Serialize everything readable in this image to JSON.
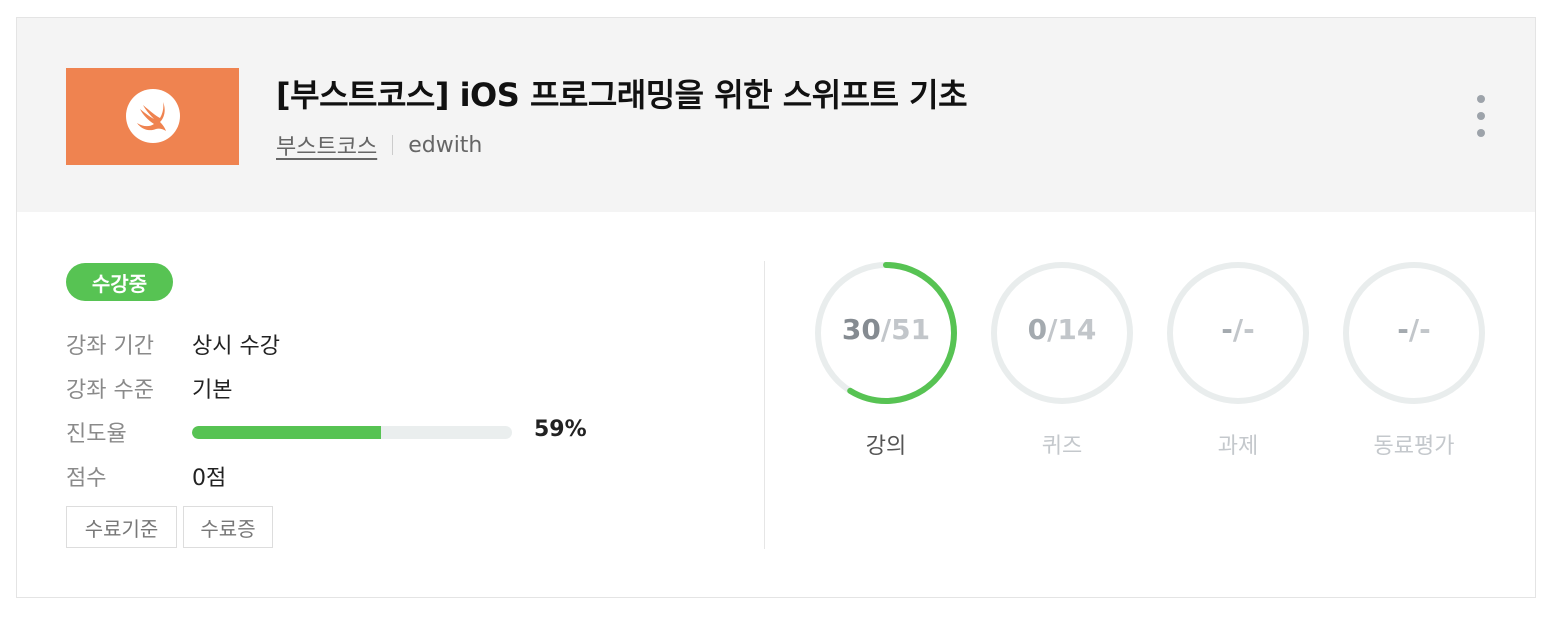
{
  "course": {
    "title": "[부스트코스] iOS 프로그래밍을 위한 스위프트 기초",
    "provider": "부스트코스",
    "platform": "edwith",
    "thumbnail_color": "#ef8350",
    "thumbnail_icon": "swift-logo-icon"
  },
  "status_badge": "수강중",
  "info": {
    "period_label": "강좌 기간",
    "period_value": "상시 수강",
    "level_label": "강좌 수준",
    "level_value": "기본",
    "progress_label": "진도율",
    "progress_percent": 59,
    "progress_text": "59%",
    "score_label": "점수",
    "score_value": "0점"
  },
  "buttons": {
    "criteria": "수료기준",
    "certificate": "수료증"
  },
  "stats": [
    {
      "label": "강의",
      "done": "30",
      "total": "/51",
      "ratio": 0.588,
      "active": true
    },
    {
      "label": "퀴즈",
      "done": "0",
      "total": "/14",
      "ratio": 0,
      "active": false
    },
    {
      "label": "과제",
      "done": "-",
      "total": "/-",
      "ratio": 0,
      "active": false
    },
    {
      "label": "동료평가",
      "done": "-",
      "total": "/-",
      "ratio": 0,
      "active": false
    }
  ],
  "colors": {
    "accent": "#57c353",
    "ring_track": "#e9eded",
    "header_bg": "#f4f4f4"
  }
}
